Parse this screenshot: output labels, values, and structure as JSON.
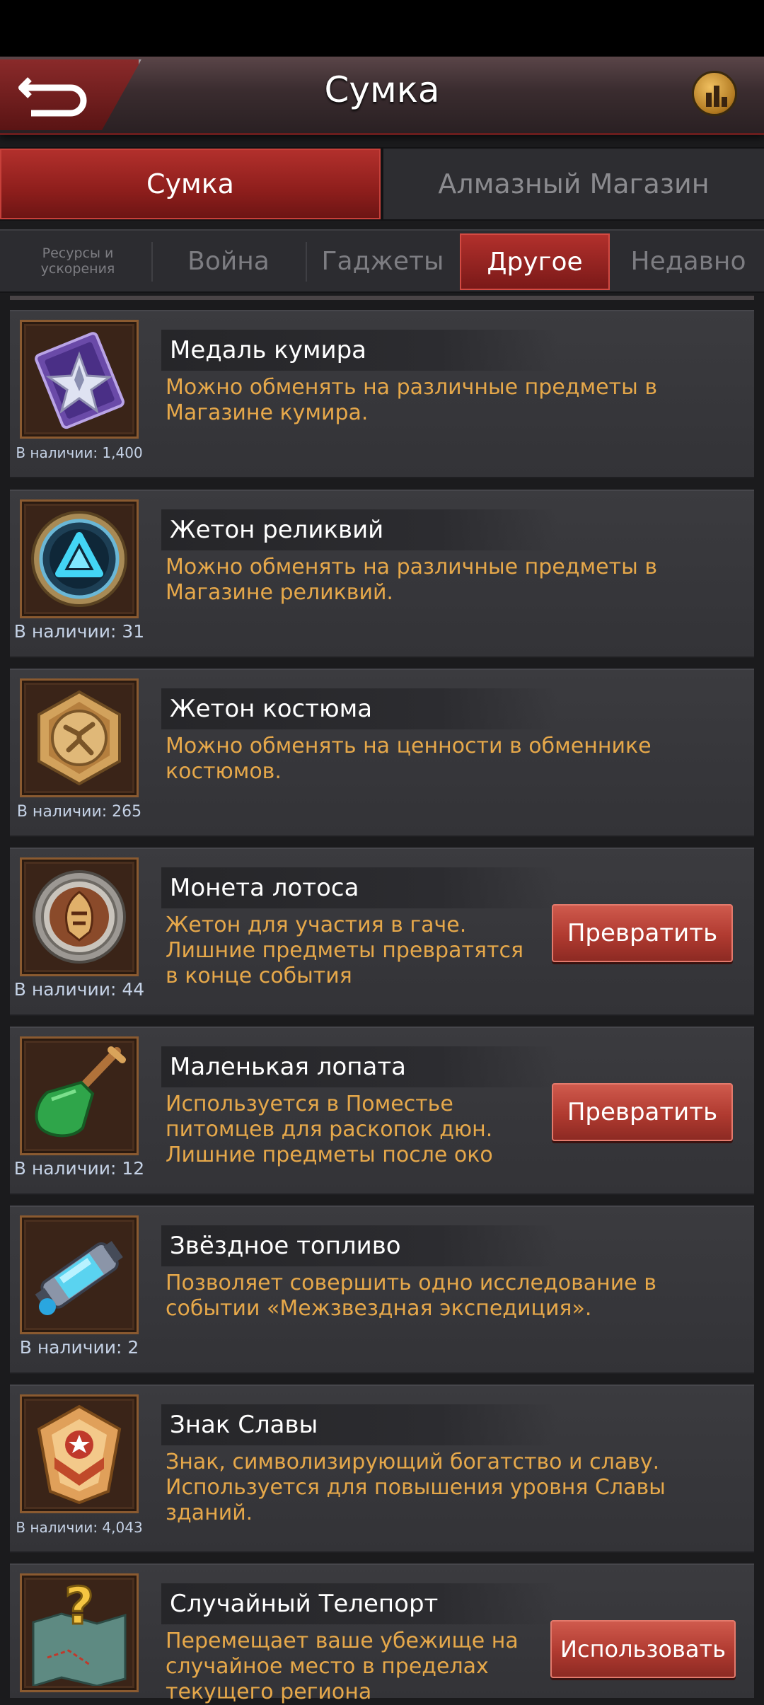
{
  "header": {
    "title": "Сумка"
  },
  "main_tabs": [
    {
      "label": "Сумка",
      "active": true
    },
    {
      "label": "Алмазный Магазин",
      "active": false
    }
  ],
  "sub_tabs": [
    {
      "label": "Ресурсы и ускорения"
    },
    {
      "label": "Война"
    },
    {
      "label": "Гаджеты"
    },
    {
      "label": "Другое",
      "active": true
    },
    {
      "label": "Недавно"
    }
  ],
  "items": [
    {
      "name": "Медаль кумира",
      "desc": "Можно обменять на различные предметы в Магазине кумира.",
      "count": "В наличии: 1,400",
      "icon": "idol-medal-icon"
    },
    {
      "name": "Жетон реликвий",
      "desc": "Можно обменять на различные предметы в Магазине реликвий.",
      "count": "В наличии: 31",
      "icon": "relic-token-icon"
    },
    {
      "name": "Жетон костюма",
      "desc": "Можно обменять на ценности в обменнике костюмов.",
      "count": "В наличии: 265",
      "icon": "costume-token-icon"
    },
    {
      "name": "Монета лотоса",
      "desc": "Жетон для участия в гаче. Лишние предметы превратятся в конце события",
      "count": "В наличии: 44",
      "icon": "lotus-coin-icon",
      "button": "Превратить"
    },
    {
      "name": "Маленькая лопата",
      "desc": "Используется в Поместье питомцев для раскопок дюн. Лишние предметы после око",
      "count": "В наличии: 12",
      "icon": "shovel-icon",
      "button": "Превратить"
    },
    {
      "name": "Звёздное топливо",
      "desc": "Позволяет совершить одно исследование в событии «Межзвездная экспедиция».",
      "count": "В наличии: 2",
      "icon": "star-fuel-icon"
    },
    {
      "name": "Знак Славы",
      "desc": "Знак, символизирующий богатство и славу. Используется для повышения уровня Славы зданий.",
      "count": "В наличии: 4,043",
      "icon": "glory-badge-icon"
    },
    {
      "name": "Случайный Телепорт",
      "desc": "Перемещает ваше убежище на случайное место в пределах текущего региона",
      "count": "",
      "icon": "random-teleport-icon",
      "button": "Использовать"
    }
  ],
  "colors": {
    "accent_red": "#b2302c",
    "desc_text": "#e6a84a",
    "count_text": "#c5d2e6"
  }
}
